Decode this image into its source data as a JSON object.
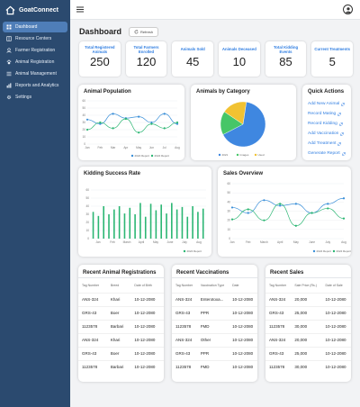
{
  "app": {
    "name": "GoatConnect"
  },
  "sidebar": {
    "items": [
      {
        "label": "Dashboard",
        "icon": "dashboard-icon",
        "active": true
      },
      {
        "label": "Resource Centers",
        "icon": "book-icon"
      },
      {
        "label": "Farmer Registration",
        "icon": "user-icon"
      },
      {
        "label": "Animal Registration",
        "icon": "paw-icon"
      },
      {
        "label": "Animal Management",
        "icon": "list-icon"
      },
      {
        "label": "Reports and Analytics",
        "icon": "chart-icon"
      },
      {
        "label": "Settings",
        "icon": "gear-icon"
      }
    ]
  },
  "header": {
    "title": "Dashboard",
    "refresh_label": "Refresh"
  },
  "stats": [
    {
      "label": "Total Registered Animals",
      "value": "250"
    },
    {
      "label": "Total Farmers Enrolled",
      "value": "120"
    },
    {
      "label": "Animals Sold",
      "value": "45"
    },
    {
      "label": "Animals Deceased",
      "value": "10"
    },
    {
      "label": "Total Kidding Events",
      "value": "85"
    },
    {
      "label": "Current Treatments",
      "value": "5"
    }
  ],
  "quick_actions": {
    "title": "Quick Actions",
    "items": [
      "Add New Animal",
      "Record Mating",
      "Record Kidding",
      "Add Vaccination",
      "Add Treatment",
      "Generate Report"
    ]
  },
  "chart_data": [
    {
      "type": "line",
      "title": "Animal Population",
      "categories": [
        "Jan",
        "Feb",
        "Mar",
        "Apr",
        "May",
        "Jun",
        "Jul",
        "Aug"
      ],
      "ylim": [
        0,
        60
      ],
      "yticks": [
        "0",
        "10",
        "20",
        "30",
        "40",
        "50",
        "60"
      ],
      "legend": "bottom",
      "colors": [
        "#3a8fd8",
        "#2bb673"
      ],
      "series": [
        {
          "name": "2024 Report",
          "values": [
            34,
            28,
            42,
            36,
            38,
            30,
            42,
            28
          ]
        },
        {
          "name": "2024 Report",
          "values": [
            20,
            30,
            22,
            35,
            16,
            28,
            22,
            30
          ]
        }
      ]
    },
    {
      "type": "pie",
      "title": "Animals by Category",
      "categories": [
        "2021",
        "Images",
        "Used"
      ],
      "values": [
        65,
        17,
        18
      ],
      "colors": [
        "#3f87e0",
        "#46c667",
        "#f1c232"
      ],
      "legend": "bottom"
    },
    {
      "type": "bar",
      "title": "Kidding Success Rate",
      "categories": [
        "Jan",
        "Feb",
        "March",
        "April",
        "May",
        "June",
        "July",
        "Aug"
      ],
      "values": [
        33,
        28,
        40,
        30,
        36,
        40,
        31,
        38,
        30,
        44,
        27,
        43,
        35,
        42,
        31,
        44,
        36,
        39,
        27,
        40,
        33,
        37
      ],
      "ylim": [
        0,
        60
      ],
      "yticks": [
        "0",
        "10",
        "20",
        "30",
        "40",
        "50",
        "60"
      ],
      "legend": "bottom",
      "colors": [
        "#2bb673"
      ],
      "series": [
        {
          "name": "2024 Report"
        }
      ]
    },
    {
      "type": "line",
      "title": "Sales Overview",
      "categories": [
        "Jan",
        "Feb",
        "March",
        "April",
        "May",
        "June",
        "July",
        "Aug"
      ],
      "ylim": [
        0,
        60
      ],
      "yticks": [
        "0",
        "10",
        "20",
        "30",
        "40",
        "50",
        "60"
      ],
      "legend": "bottom",
      "colors": [
        "#3a8fd8",
        "#2bb673"
      ],
      "series": [
        {
          "name": "2024 Report",
          "values": [
            34,
            28,
            42,
            36,
            38,
            28,
            38,
            44
          ]
        },
        {
          "name": "2024 Report",
          "values": [
            21,
            32,
            20,
            38,
            14,
            28,
            33,
            22
          ]
        }
      ]
    }
  ],
  "tables": {
    "registrations": {
      "title": "Recent Animal Registrations",
      "headers": [
        "Tag Number",
        "Breed",
        "Date of Birth"
      ],
      "rows": [
        [
          "ANS-324",
          "Khari",
          "10-12-2080"
        ],
        [
          "GRS-43",
          "Boer",
          "10-12-2080"
        ],
        [
          "1123578",
          "Barbari",
          "10-12-2080"
        ],
        [
          "ANS-324",
          "Khari",
          "10-12-2080"
        ],
        [
          "GRS-43",
          "Boer",
          "10-12-2080"
        ],
        [
          "1123578",
          "Barbari",
          "10-12-2080"
        ]
      ]
    },
    "vaccinations": {
      "title": "Recent Vaccinations",
      "headers": [
        "Tag Number",
        "Vaccination Type",
        "Date"
      ],
      "rows": [
        [
          "ANS-324",
          "Enterotoxa...",
          "10-12-2080"
        ],
        [
          "GRS-43",
          "PPR",
          "10-12-2080"
        ],
        [
          "1123578",
          "FMD",
          "10-12-2080"
        ],
        [
          "ANS-324",
          "Other",
          "10-12-2080"
        ],
        [
          "GRS-43",
          "PPR",
          "10-12-2080"
        ],
        [
          "1123578",
          "FMD",
          "10-12-2080"
        ]
      ]
    },
    "sales": {
      "title": "Recent Sales",
      "headers": [
        "Tag Number",
        "Sale Price (Rs.)",
        "Date of Sale"
      ],
      "rows": [
        [
          "ANS-324",
          "20,000",
          "10-12-2080"
        ],
        [
          "GRS-43",
          "25,000",
          "10-12-2080"
        ],
        [
          "1123578",
          "30,000",
          "10-12-2080"
        ],
        [
          "ANS-324",
          "20,000",
          "10-12-2080"
        ],
        [
          "GRS-43",
          "25,000",
          "10-12-2080"
        ],
        [
          "1123578",
          "30,000",
          "10-12-2080"
        ]
      ]
    }
  }
}
